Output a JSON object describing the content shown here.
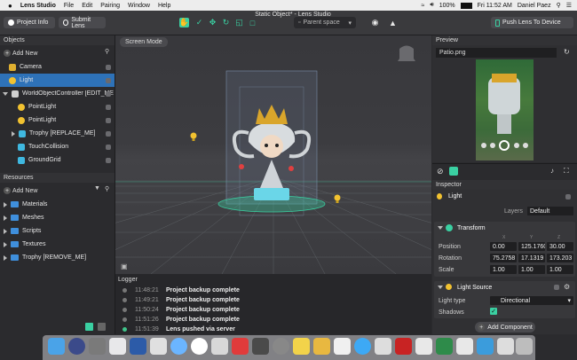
{
  "menubar": {
    "app": "Lens Studio",
    "items": [
      "File",
      "Edit",
      "Pairing",
      "Window",
      "Help"
    ],
    "battery": "100%",
    "clock": "Fri 11:52 AM",
    "user": "Daniel Paez"
  },
  "toolbar": {
    "project_info": "Project Info",
    "submit_lens": "Submit Lens",
    "window_title": "Static Object* - Lens Studio",
    "space_selector": "Parent space",
    "push_lens": "Push Lens To Device"
  },
  "objects": {
    "header": "Objects",
    "add_new": "Add New",
    "items": [
      {
        "label": "Camera",
        "color": "#e0b030"
      },
      {
        "label": "Light",
        "color": "#f2c230"
      },
      {
        "label": "WorldObjectController [EDIT_ME]",
        "color": "#d0d0d0"
      },
      {
        "label": "PointLight",
        "color": "#f2c230"
      },
      {
        "label": "PointLight",
        "color": "#f2c230"
      },
      {
        "label": "Trophy [REPLACE_ME]",
        "color": "#3fb8e0"
      },
      {
        "label": "TouchCollision",
        "color": "#3fb8e0"
      },
      {
        "label": "GroundGrid",
        "color": "#3fb8e0"
      }
    ]
  },
  "resources": {
    "header": "Resources",
    "add_new": "Add New",
    "items": [
      "Materials",
      "Meshes",
      "Scripts",
      "Textures",
      "Trophy [REMOVE_ME]"
    ]
  },
  "viewport": {
    "mode_button": "Screen Mode"
  },
  "logger": {
    "header": "Logger",
    "entries": [
      {
        "time": "11:48:21",
        "message": "Project backup complete",
        "status": "info"
      },
      {
        "time": "11:49:21",
        "message": "Project backup complete",
        "status": "info"
      },
      {
        "time": "11:50:24",
        "message": "Project backup complete",
        "status": "info"
      },
      {
        "time": "11:51:26",
        "message": "Project backup complete",
        "status": "info"
      },
      {
        "time": "11:51:39",
        "message": "Lens pushed via server",
        "status": "success"
      }
    ]
  },
  "preview": {
    "header": "Preview",
    "file": "Patio.png"
  },
  "inspector": {
    "header": "Inspector",
    "object_name": "Light",
    "layers_label": "Layers",
    "layers_value": "Default",
    "transform": {
      "title": "Transform",
      "axes": [
        "X",
        "Y",
        "Z"
      ],
      "position_label": "Position",
      "position": [
        "0.00",
        "125.1760",
        "30.00"
      ],
      "rotation_label": "Rotation",
      "rotation": [
        "75.2758",
        "17.1319",
        "173.203"
      ],
      "scale_label": "Scale",
      "scale": [
        "1.00",
        "1.00",
        "1.00"
      ]
    },
    "light_source": {
      "title": "Light Source",
      "type_label": "Light type",
      "type_value": "Directional",
      "shadows_label": "Shadows",
      "shadows_checked": true
    },
    "add_component": "Add Component"
  },
  "colors": {
    "accent": "#3ad0a2",
    "selection": "#2e72b8",
    "panel": "#2b2b2e"
  }
}
